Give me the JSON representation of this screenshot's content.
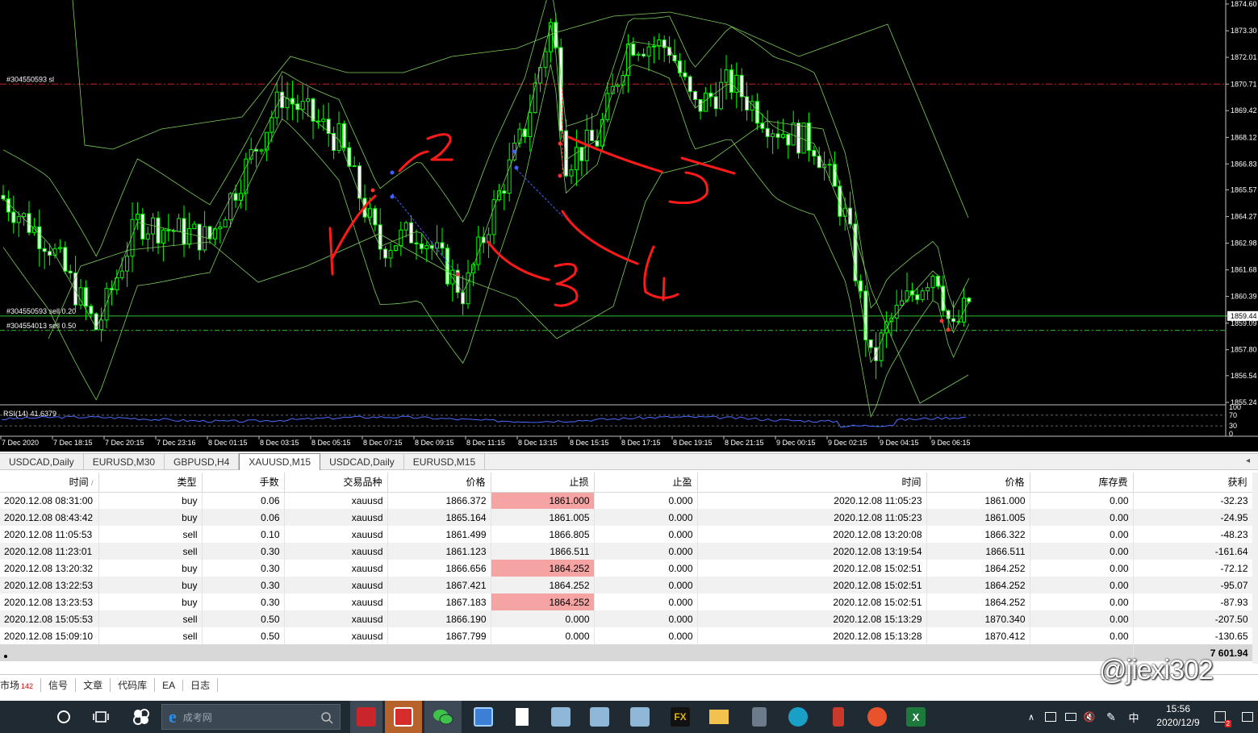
{
  "chart": {
    "symbol": "XAUUSD",
    "timeframe": "M15",
    "price_axis": [
      "1874.60",
      "1873.30",
      "1872.01",
      "1870.71",
      "1869.42",
      "1868.12",
      "1866.83",
      "1865.57",
      "1864.27",
      "1862.98",
      "1861.68",
      "1860.39",
      "1859.44",
      "1859.09",
      "1857.80",
      "1856.54",
      "1855.24"
    ],
    "current_price": "1859.44",
    "time_axis": [
      "7 Dec 2020",
      "7 Dec 18:15",
      "7 Dec 20:15",
      "7 Dec 23:16",
      "8 Dec 01:15",
      "8 Dec 03:15",
      "8 Dec 05:15",
      "8 Dec 07:15",
      "8 Dec 09:15",
      "8 Dec 11:15",
      "8 Dec 13:15",
      "8 Dec 15:15",
      "8 Dec 17:15",
      "8 Dec 19:15",
      "8 Dec 21:15",
      "9 Dec 00:15",
      "9 Dec 02:15",
      "9 Dec 04:15",
      "9 Dec 06:15"
    ],
    "order_lines": [
      {
        "label": "#304550593 sl",
        "price": "1870.71",
        "style": "red"
      },
      {
        "label": "#304550593 sell 0.20",
        "price": "1859.44",
        "style": "green"
      },
      {
        "label": "#304554013 sell 0.50",
        "price": "1859.09",
        "style": "green"
      }
    ],
    "indicator_label": "RSI(14) 41.6379",
    "rsi_levels": [
      "100",
      "70",
      "30",
      "0"
    ],
    "handwritten_marks": [
      "1",
      "2",
      "3",
      "4",
      "5"
    ]
  },
  "chart_tabs": [
    {
      "label": "USDCAD,Daily",
      "active": false
    },
    {
      "label": "EURUSD,M30",
      "active": false
    },
    {
      "label": "GBPUSD,H4",
      "active": false
    },
    {
      "label": "XAUUSD,M15",
      "active": true
    },
    {
      "label": "USDCAD,Daily",
      "active": false
    },
    {
      "label": "EURUSD,M15",
      "active": false
    }
  ],
  "table": {
    "headers": [
      "时间",
      "类型",
      "手数",
      "交易品种",
      "价格",
      "止损",
      "止盈",
      "时间",
      "价格",
      "库存费",
      "获利"
    ],
    "rows": [
      [
        "2020.12.08 08:31:00",
        "buy",
        "0.06",
        "xauusd",
        "1866.372",
        "1861.000",
        "0.000",
        "2020.12.08 11:05:23",
        "1861.000",
        "0.00",
        "-32.23"
      ],
      [
        "2020.12.08 08:43:42",
        "buy",
        "0.06",
        "xauusd",
        "1865.164",
        "1861.005",
        "0.000",
        "2020.12.08 11:05:23",
        "1861.005",
        "0.00",
        "-24.95"
      ],
      [
        "2020.12.08 11:05:53",
        "sell",
        "0.10",
        "xauusd",
        "1861.499",
        "1866.805",
        "0.000",
        "2020.12.08 13:20:08",
        "1866.322",
        "0.00",
        "-48.23"
      ],
      [
        "2020.12.08 11:23:01",
        "sell",
        "0.30",
        "xauusd",
        "1861.123",
        "1866.511",
        "0.000",
        "2020.12.08 13:19:54",
        "1866.511",
        "0.00",
        "-161.64"
      ],
      [
        "2020.12.08 13:20:32",
        "buy",
        "0.30",
        "xauusd",
        "1866.656",
        "1864.252",
        "0.000",
        "2020.12.08 15:02:51",
        "1864.252",
        "0.00",
        "-72.12"
      ],
      [
        "2020.12.08 13:22:53",
        "buy",
        "0.30",
        "xauusd",
        "1867.421",
        "1864.252",
        "0.000",
        "2020.12.08 15:02:51",
        "1864.252",
        "0.00",
        "-95.07"
      ],
      [
        "2020.12.08 13:23:53",
        "buy",
        "0.30",
        "xauusd",
        "1867.183",
        "1864.252",
        "0.000",
        "2020.12.08 15:02:51",
        "1864.252",
        "0.00",
        "-87.93"
      ],
      [
        "2020.12.08 15:05:53",
        "sell",
        "0.50",
        "xauusd",
        "1866.190",
        "0.000",
        "0.000",
        "2020.12.08 15:13:29",
        "1870.340",
        "0.00",
        "-207.50"
      ],
      [
        "2020.12.08 15:09:10",
        "sell",
        "0.50",
        "xauusd",
        "1867.799",
        "0.000",
        "0.000",
        "2020.12.08 15:13:28",
        "1870.412",
        "0.00",
        "-130.65"
      ]
    ],
    "sl_highlight_rows": [
      0,
      1,
      3,
      4,
      5,
      6
    ],
    "total": "7 601.94"
  },
  "terminal_tabs": [
    {
      "label": "市场",
      "badge": "142"
    },
    {
      "label": "信号"
    },
    {
      "label": "文章"
    },
    {
      "label": "代码库"
    },
    {
      "label": "EA"
    },
    {
      "label": "日志"
    }
  ],
  "taskbar": {
    "search_placeholder": "成考网",
    "clock_time": "15:56",
    "clock_date": "2020/12/9",
    "ime": "中",
    "notification_count": "2",
    "watermark": "@jiexi302"
  },
  "colors": {
    "chart_bg": "#000000",
    "candle": "#00ff00",
    "band": "#7ccf5a",
    "sl_line": "#d02020",
    "order_line": "#2ec42e",
    "pen": "#ff1a1a",
    "sl_hit_cell": "#f5a3a3"
  }
}
